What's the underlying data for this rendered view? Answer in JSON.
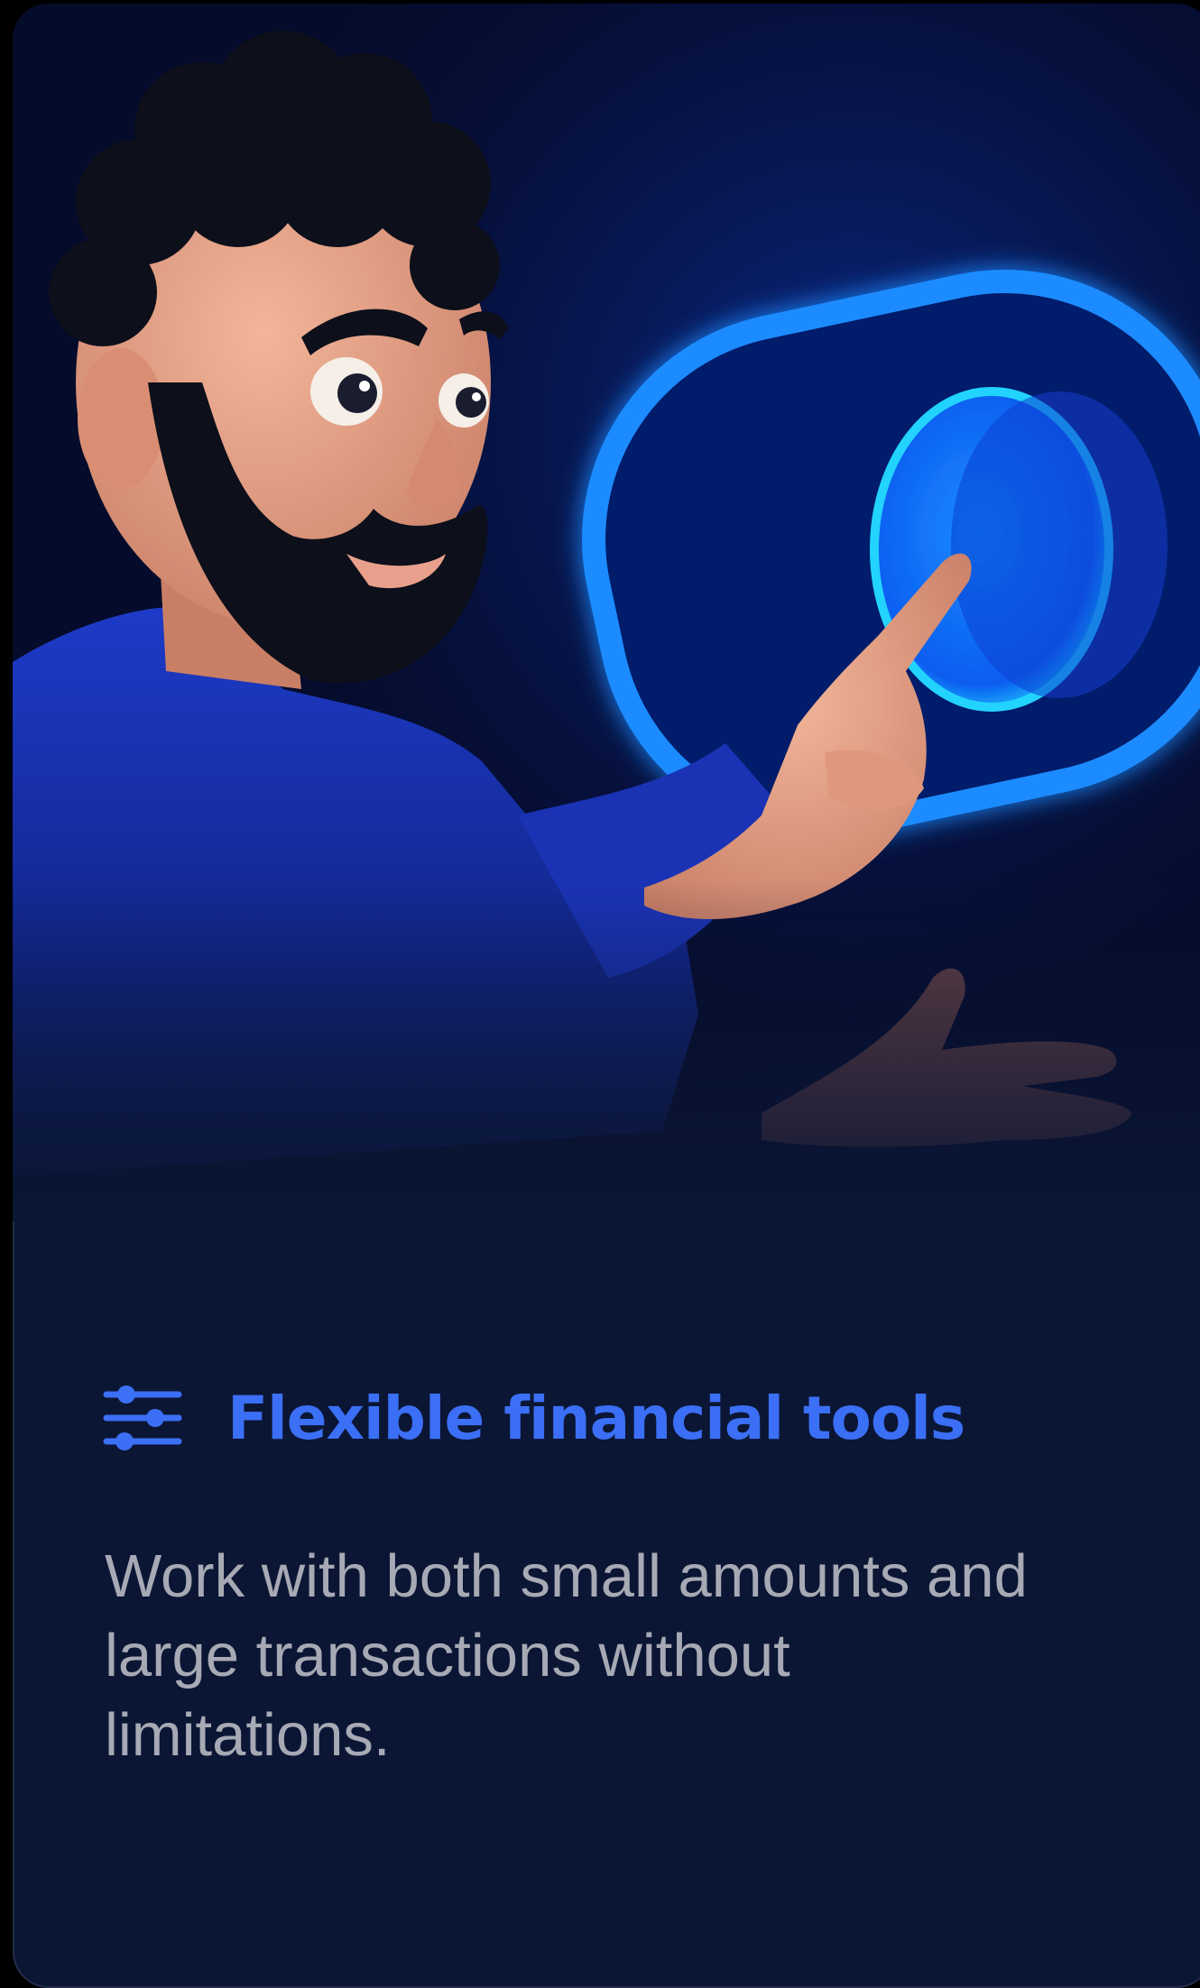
{
  "feature": {
    "icon": "sliders-icon",
    "title": "Flexible financial tools",
    "description": "Work with both small amounts and large transactions without limitations."
  },
  "colors": {
    "background": "#0b1635",
    "accent": "#3b6ff5",
    "description_text": "#a7a9b4",
    "glow": "#1e8bff"
  },
  "hero": {
    "illustration": "bearded-man-pressing-glowing-toggle-illustration"
  }
}
